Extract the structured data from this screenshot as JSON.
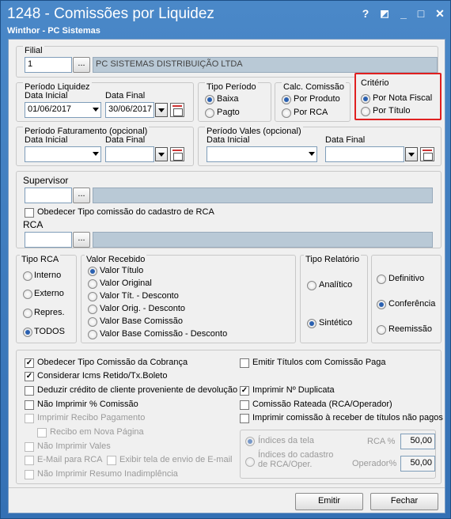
{
  "window": {
    "title": "1248 - Comissões por Liquidez",
    "subtitle": "Winthor - PC Sistemas",
    "help": "?",
    "minimize": "_",
    "maximize": "□",
    "close": "✕"
  },
  "filial": {
    "label": "Filial",
    "code": "1",
    "name": "PC SISTEMAS DISTRIBUIÇÃO LTDA",
    "browse": "..."
  },
  "periodo_liquidez": {
    "label": "Período Liquidez",
    "inicial_label": "Data Inicial",
    "inicial": "01/06/2017",
    "final_label": "Data Final",
    "final": "30/06/2017"
  },
  "tipo_periodo": {
    "label": "Tipo Período",
    "options": [
      "Baixa",
      "Pagto"
    ]
  },
  "calc_comissao": {
    "label": "Calc. Comissão",
    "options": [
      "Por Produto",
      "Por RCA"
    ]
  },
  "criterio": {
    "label": "Critério",
    "options": [
      "Por Nota Fiscal",
      "Por Título"
    ]
  },
  "periodo_faturamento": {
    "label": "Período Faturamento  (opcional)",
    "inicial_label": "Data Inicial",
    "final_label": "Data Final"
  },
  "periodo_vales": {
    "label": "Período Vales  (opcional)",
    "inicial_label": "Data Inicial",
    "final_label": "Data Final"
  },
  "supervisor": {
    "label": "Supervisor",
    "browse": "...",
    "check": "Obedecer Tipo comissão do cadastro de RCA"
  },
  "rca": {
    "label": "RCA",
    "browse": "..."
  },
  "tipo_rca": {
    "label": "Tipo RCA",
    "options": [
      "Interno",
      "Externo",
      "Repres.",
      "TODOS"
    ]
  },
  "valor_recebido": {
    "label": "Valor Recebido",
    "options": [
      "Valor Título",
      "Valor Original",
      "Valor Tít. - Desconto",
      "Valor Orig. - Desconto",
      "Valor Base Comissão",
      "Valor Base Comissão - Desconto"
    ]
  },
  "tipo_relatorio": {
    "label": "Tipo Relatório",
    "options": [
      "Analítico",
      "Sintético"
    ]
  },
  "modo": {
    "options": [
      "Definitivo",
      "Conferência",
      "Reemissão"
    ]
  },
  "checks": {
    "c1": "Obedecer Tipo Comissão da Cobrança",
    "c2": "Considerar Icms Retido/Tx.Boleto",
    "c3": "Deduzir crédito de cliente proveniente de devolução",
    "c4": "Não Imprimir % Comissão",
    "c5": "Imprimir Recibo Pagamento",
    "c6": "Recibo em Nova Página",
    "c7": "Não Imprimir Vales",
    "c8": "E-Mail para RCA",
    "c9": "Exibir tela de envio de E-mail",
    "c10": "Não Imprimir Resumo Inadimplência",
    "r1": "Emitir Títulos com Comissão Paga",
    "r2": "Imprimir Nº Duplicata",
    "r3": "Comissão Rateada (RCA/Operador)",
    "r4": "Imprimir comissão à receber de títulos não pagos"
  },
  "indices": {
    "opt1": "Índices da tela",
    "opt2": "Índices do cadastro de RCA/Oper.",
    "rca_label": "RCA %",
    "rca_value": "50,00",
    "op_label": "Operador%",
    "op_value": "50,00"
  },
  "footer": {
    "emitir": "Emitir",
    "fechar": "Fechar"
  },
  "colors": {
    "highlight": "#e02020",
    "title_bar": "#3f7fc0"
  }
}
